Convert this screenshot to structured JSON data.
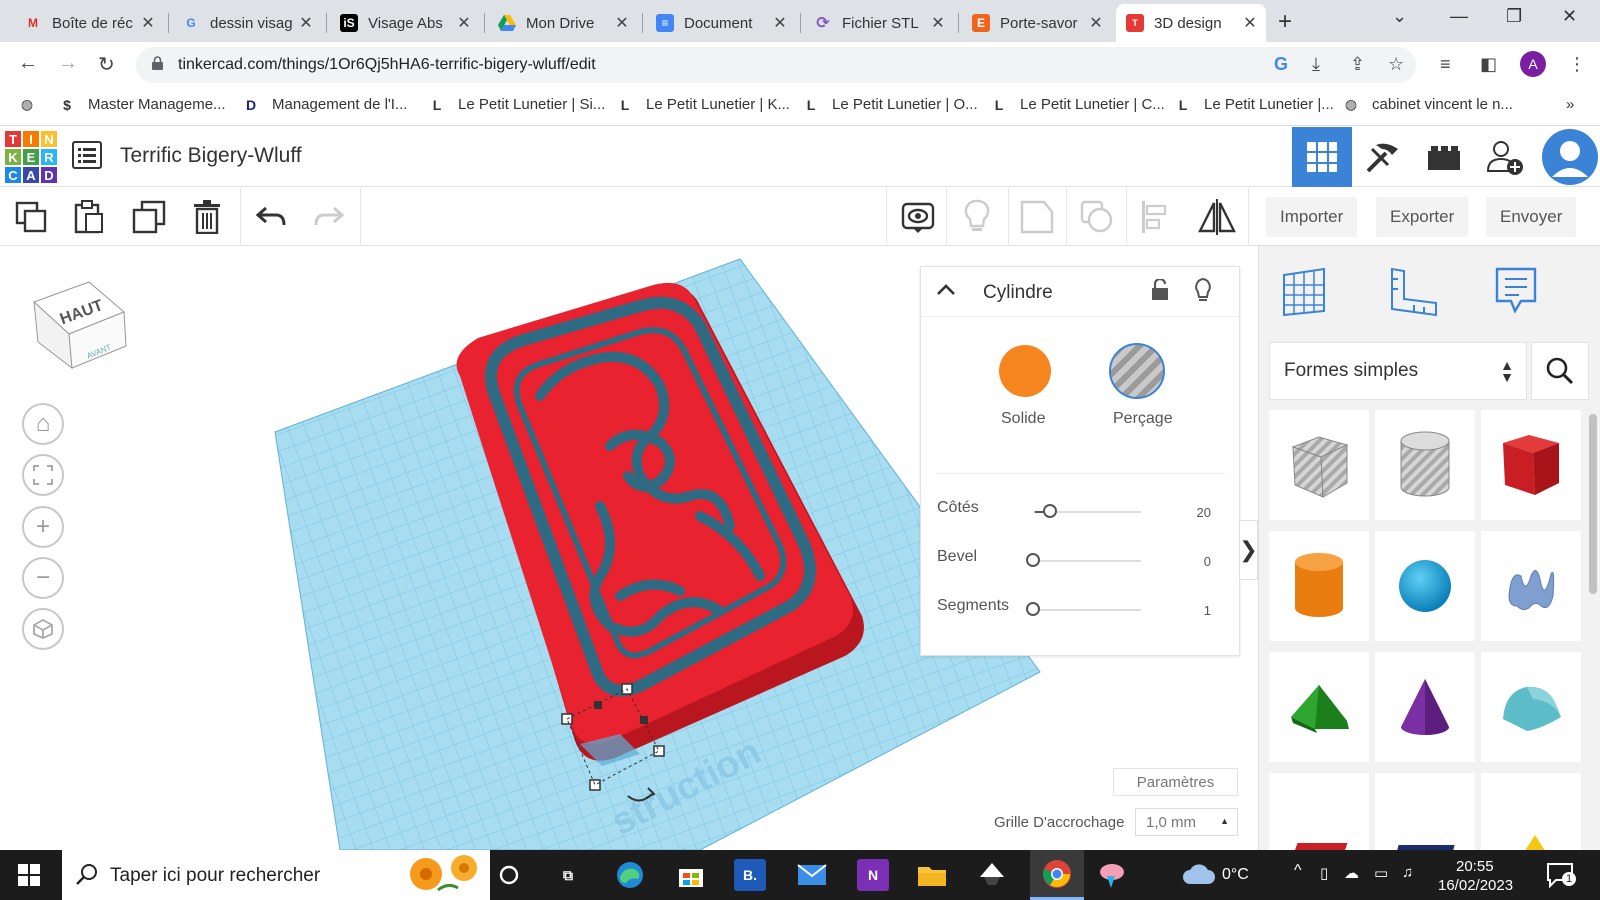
{
  "browser": {
    "tabs": [
      {
        "label": "Boîte de réc",
        "icon": "gmail-icon"
      },
      {
        "label": "dessin visag",
        "icon": "google-icon"
      },
      {
        "label": "Visage Abs",
        "icon": "istock-icon"
      },
      {
        "label": "Mon Drive",
        "icon": "drive-icon"
      },
      {
        "label": "Document",
        "icon": "docs-icon"
      },
      {
        "label": "Fichier STL",
        "icon": "stl-icon"
      },
      {
        "label": "Porte-savor",
        "icon": "etsy-icon"
      },
      {
        "label": "3D design",
        "icon": "tinkercad-icon",
        "active": true
      }
    ],
    "url": "tinkercad.com/things/1Or6Qj5hHA6-terrific-bigery-wluff/edit",
    "profile_initial": "A",
    "bookmarks": [
      {
        "label": "",
        "icon": "globe-icon"
      },
      {
        "label": "Master Manageme...",
        "icon": "S"
      },
      {
        "label": "Management de l'I...",
        "icon": "D"
      },
      {
        "label": "Le Petit Lunetier | Si...",
        "icon": "L"
      },
      {
        "label": "Le Petit Lunetier | K...",
        "icon": "L"
      },
      {
        "label": "Le Petit Lunetier | O...",
        "icon": "L"
      },
      {
        "label": "Le Petit Lunetier | C...",
        "icon": "L"
      },
      {
        "label": "Le Petit Lunetier |...",
        "icon": "L"
      },
      {
        "label": "cabinet vincent le n...",
        "icon": "globe-icon"
      }
    ],
    "more_bookmarks": "»"
  },
  "app": {
    "logo_letters": [
      "T",
      "I",
      "N",
      "K",
      "E",
      "R",
      "C",
      "A",
      "D"
    ],
    "project_title": "Terrific Bigery-Wluff"
  },
  "toolbar": {
    "import_label": "Importer",
    "export_label": "Exporter",
    "send_label": "Envoyer"
  },
  "viewcube": {
    "top_label": "HAUT",
    "front_label": "AVANT"
  },
  "inspector": {
    "title": "Cylindre",
    "solid_label": "Solide",
    "hole_label": "Perçage",
    "solid_color": "#f5861f",
    "properties": [
      {
        "label": "Côtés",
        "value": "20",
        "fraction": 0.12
      },
      {
        "label": "Bevel",
        "value": "0",
        "fraction": 0.0
      },
      {
        "label": "Segments",
        "value": "1",
        "fraction": 0.0
      }
    ]
  },
  "workplane": {
    "params_label": "Paramètres",
    "snap_label": "Grille D'accrochage",
    "snap_value": "1,0 mm",
    "watermark": "struction"
  },
  "library": {
    "category": "Formes simples",
    "shapes": [
      "box-hole",
      "cylinder-hole",
      "box",
      "cylinder",
      "sphere",
      "scribble",
      "roof",
      "cone",
      "round-roof"
    ]
  },
  "taskbar": {
    "search_placeholder": "Taper ici pour rechercher",
    "weather": "0°C",
    "time": "20:55",
    "date": "16/02/2023",
    "notifications": "1"
  },
  "colors": {
    "accent": "#3b83d7",
    "model_red": "#e8222f",
    "outline_teal": "#2f6a83",
    "grid_blue": "#a8dcf0"
  }
}
